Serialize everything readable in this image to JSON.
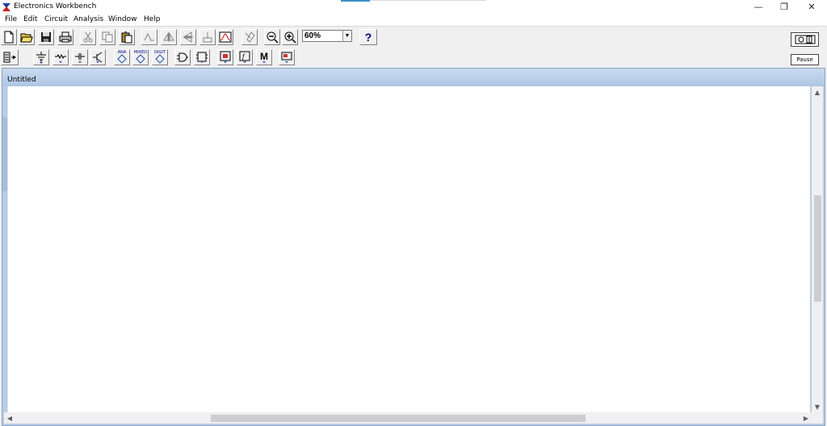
{
  "window": {
    "title": "Electronics Workbench",
    "controls": {
      "minimize": "—",
      "restore": "❐",
      "close": "✕"
    }
  },
  "menu": [
    "File",
    "Edit",
    "Circuit",
    "Analysis",
    "Window",
    "Help"
  ],
  "toolbar": {
    "zoom_value": "60%",
    "help_label": "?",
    "pause_label": "Pause",
    "parts_labels": {
      "analog": "ANA",
      "mixed": "MIXED",
      "digital": "DIGIT",
      "misc": "M"
    }
  },
  "document": {
    "title": "Untitled"
  },
  "colors": {
    "accent": "#3a8fc4",
    "child_frame": "#b8cde6"
  }
}
